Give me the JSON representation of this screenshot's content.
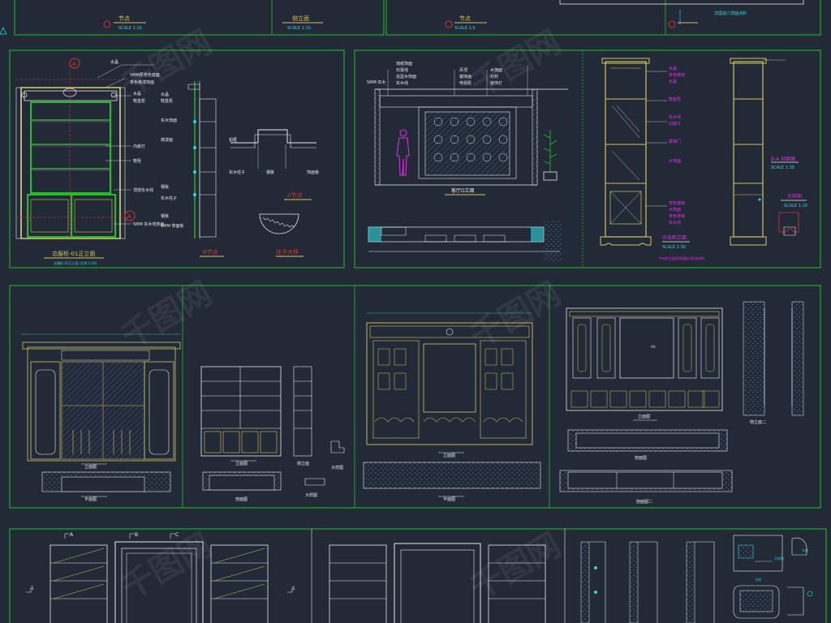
{
  "top_strip": [
    {
      "title": "节点",
      "scale": "SCALE  1:10"
    },
    {
      "title": "侧立面",
      "scale": "SCALE  1:10"
    },
    {
      "title": "节点",
      "scale": "SCALE  1:5"
    },
    {
      "note": "法国进口顶面涂料"
    }
  ],
  "panels": {
    "main_cabinet": {
      "title": "总服柜-01正立面",
      "sub": "总服柜-01正立面  (比例 1:30)",
      "section_marker": "A",
      "labels_left": [
        "水晶",
        "5MM厚茶色镜面",
        "茶色烤漆饰面",
        "水晶",
        "鞋盒柜",
        "内嵌灯",
        "鞋柜",
        "顶部实木线",
        "5MM 实木线饰面"
      ],
      "labels_right": [
        "水晶",
        "鞋盒柜",
        "实木饰面",
        "烤漆面",
        "钢板",
        "实木柱子",
        "钢板",
        "5MM 饰面板"
      ],
      "node_a_title": "A节点",
      "node_b_title": "B节点",
      "column_title": "柱子大样",
      "node_labels": [
        "铝框",
        "实木柱子",
        "钢板",
        "饰面板"
      ]
    },
    "living_room": {
      "title": "客厅D立面",
      "labels_top": [
        "5MM 实木",
        "墙纸饰面",
        "石膏线",
        "造型木饰面",
        "实木线",
        "吊顶",
        "装饰画",
        "电视柜",
        "木饰面",
        "石材",
        "装饰灯"
      ]
    },
    "cabinet_elevations": {
      "title_a": "中岛柜立面",
      "title_b": "B-A 剖面图",
      "title_c": "大样图",
      "scale": "SCALE  1:30",
      "scale_b": "SCALE  1:10",
      "labels": [
        "水晶",
        "茶色玻璃",
        "水晶",
        "鞋盒柜",
        "实木线",
        "内嵌灯",
        "玻璃门",
        "木饰面",
        "茶色玻璃",
        "木饰面",
        "茶色玻璃",
        "实木线"
      ],
      "note": "中岛柜立面及饰面板与柜体材料"
    },
    "row2_a": {
      "title": "立面图",
      "plan": "平面图"
    },
    "row2_b": {
      "title_elev": "立面图",
      "title_side": "侧立面",
      "title_plan": "剖面图",
      "detail": "大样图"
    },
    "row2_c": {
      "title": "立面图",
      "plan": "平面图"
    },
    "row2_d": {
      "title": "立面图",
      "plan1": "剖面图",
      "plan2": "剖面图二",
      "side": "侧立面二",
      "label": "AA"
    },
    "row3": {
      "markers": [
        "A",
        "B",
        "C"
      ],
      "side": [
        "1",
        "1"
      ],
      "detail_labels": [
        "大样",
        "大样图",
        "大样"
      ]
    }
  },
  "watermark": "千图网",
  "colors": {
    "background": "#222a38",
    "frame_green": "#1ec21e",
    "yellow": "#d4c45a",
    "cyan": "#2fd6e0",
    "magenta": "#e030e0",
    "red": "#e03030",
    "white": "#e8e8e8"
  }
}
